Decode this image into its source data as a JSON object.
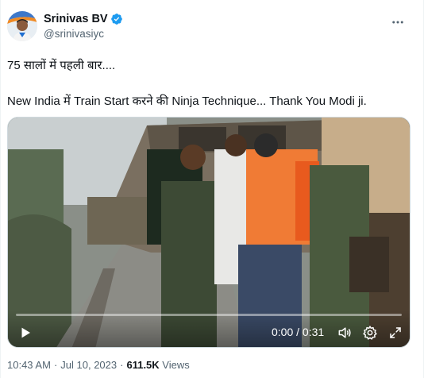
{
  "author": {
    "display_name": "Srinivas BV",
    "handle": "@srinivasiyc",
    "avatar_icon": "profile-avatar",
    "verified_icon": "verified-badge-icon",
    "verified_color": "#1d9bf0"
  },
  "tweet": {
    "line1": "75 सालों में पहली बार....",
    "line2": "New India में Train Start करने की Ninja Technique... Thank You Modi ji."
  },
  "video": {
    "current_time": "0:00",
    "separator": "/",
    "duration": "0:31",
    "progress_fraction": 0,
    "icons": [
      "play-icon",
      "volume-icon",
      "settings-gear-icon",
      "fullscreen-icon"
    ]
  },
  "meta": {
    "time": "10:43 AM",
    "dot1": "·",
    "date": "Jul 10, 2023",
    "dot2": "·",
    "views_count": "611.5K",
    "views_label": "Views"
  },
  "colors": {
    "text_primary": "#0f1419",
    "text_secondary": "#536471",
    "border": "#cfd9de"
  }
}
